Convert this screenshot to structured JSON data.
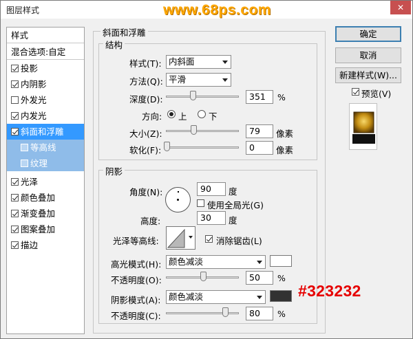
{
  "window": {
    "title": "图层样式",
    "watermark": "www.68ps.com",
    "close_glyph": "✕"
  },
  "left_panel": {
    "header": "样式",
    "blend": "混合选项:自定",
    "items": [
      {
        "label": "投影",
        "checked": true
      },
      {
        "label": "内阴影",
        "checked": true
      },
      {
        "label": "外发光",
        "checked": false
      },
      {
        "label": "内发光",
        "checked": true
      },
      {
        "label": "斜面和浮雕",
        "checked": true,
        "selected": true
      },
      {
        "label": "等高线",
        "checked": false,
        "sub": true
      },
      {
        "label": "纹理",
        "checked": false,
        "sub": true
      },
      {
        "label": "光泽",
        "checked": true
      },
      {
        "label": "颜色叠加",
        "checked": true
      },
      {
        "label": "渐变叠加",
        "checked": true
      },
      {
        "label": "图案叠加",
        "checked": true
      },
      {
        "label": "描边",
        "checked": true
      }
    ]
  },
  "bevel": {
    "section_title": "斜面和浮雕",
    "structure_title": "结构",
    "style_label": "样式(T):",
    "style_value": "内斜面",
    "method_label": "方法(Q):",
    "method_value": "平滑",
    "depth_label": "深度(D):",
    "depth_value": "351",
    "depth_unit": "%",
    "direction_label": "方向:",
    "dir_up": "上",
    "dir_down": "下",
    "size_label": "大小(Z):",
    "size_value": "79",
    "size_unit": "像素",
    "soften_label": "软化(F):",
    "soften_value": "0",
    "soften_unit": "像素"
  },
  "shading": {
    "title": "阴影",
    "angle_label": "角度(N):",
    "angle_value": "90",
    "angle_unit": "度",
    "global_light": "使用全局光(G)",
    "altitude_label": "高度:",
    "altitude_value": "30",
    "altitude_unit": "度",
    "gloss_label": "光泽等高线:",
    "antialias": "消除锯齿(L)",
    "highlight_label": "高光模式(H):",
    "highlight_value": "颜色减淡",
    "opacity1_label": "不透明度(O):",
    "opacity1_value": "50",
    "opacity1_unit": "%",
    "shadow_label": "阴影模式(A):",
    "shadow_value": "颜色减淡",
    "opacity2_label": "不透明度(C):",
    "opacity2_value": "80",
    "opacity2_unit": "%"
  },
  "buttons": {
    "ok": "确定",
    "cancel": "取消",
    "new_style": "新建样式(W)...",
    "preview": "预览(V)"
  },
  "annotation": "#323232",
  "colors": {
    "highlight_swatch": "#ffffff",
    "shadow_swatch": "#323232",
    "selected": "#3399ff",
    "sub_selected": "#8fbce9",
    "annotation": "#e60000"
  }
}
